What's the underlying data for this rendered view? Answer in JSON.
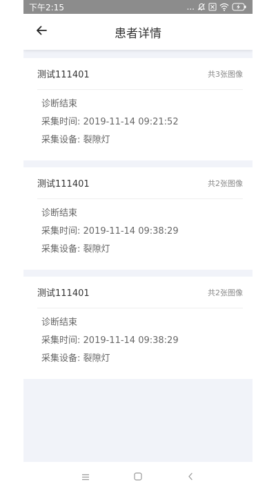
{
  "status_bar": {
    "time": "下午2:15",
    "more": "..."
  },
  "header": {
    "title": "患者详情"
  },
  "records": [
    {
      "name": "测试111401",
      "image_count": "共3张图像",
      "status": "诊断结束",
      "time_label": "采集时间",
      "time_value": "2019-11-14 09:21:52",
      "device_label": "采集设备",
      "device_value": "裂隙灯"
    },
    {
      "name": "测试111401",
      "image_count": "共2张图像",
      "status": "诊断结束",
      "time_label": "采集时间",
      "time_value": "2019-11-14 09:38:29",
      "device_label": "采集设备",
      "device_value": "裂隙灯"
    },
    {
      "name": "测试111401",
      "image_count": "共2张图像",
      "status": "诊断结束",
      "time_label": "采集时间",
      "time_value": "2019-11-14 09:38:29",
      "device_label": "采集设备",
      "device_value": "裂隙灯"
    }
  ],
  "icons": {
    "back": "arrow-left-icon",
    "menu": "menu-icon",
    "home": "square-home-icon",
    "back_nav": "chevron-left-icon"
  },
  "colors": {
    "status_bar": "#8c8c8c",
    "page_bg": "#f1f3f9",
    "title": "#333333",
    "secondary": "#888888"
  }
}
